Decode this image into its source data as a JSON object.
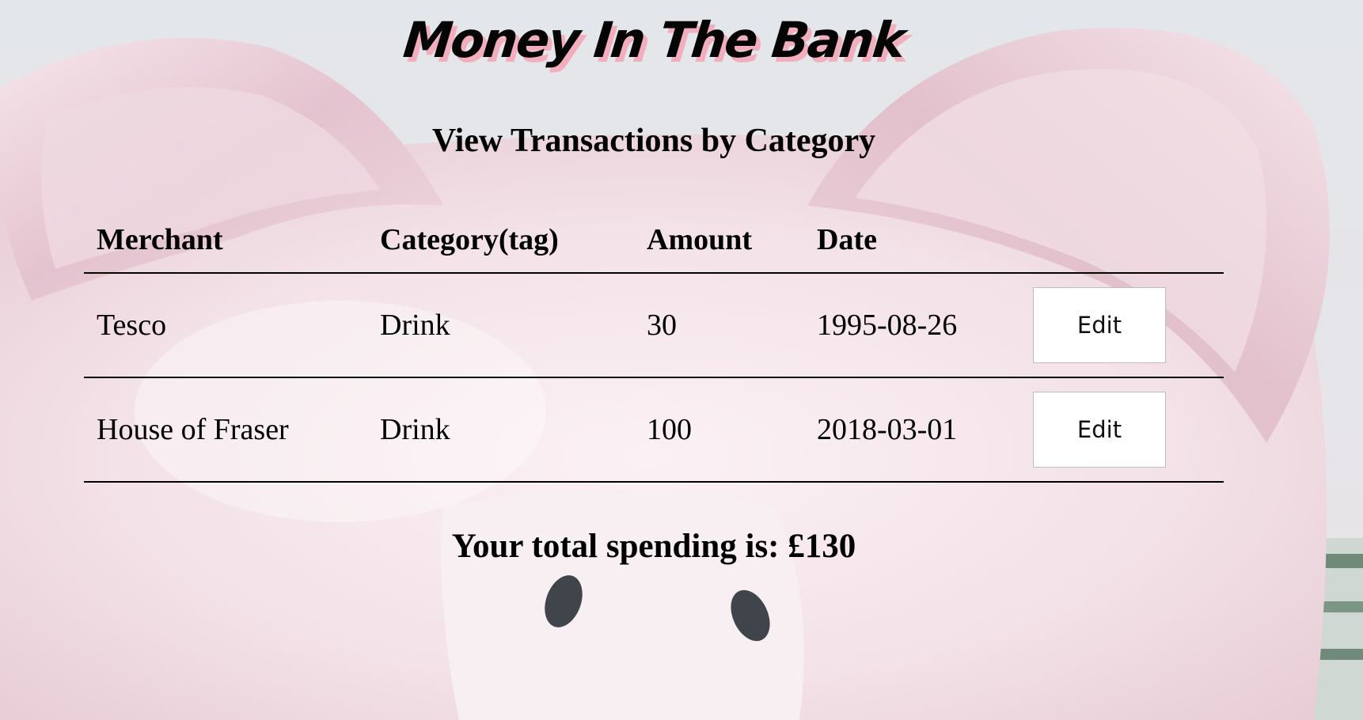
{
  "header": {
    "title": "Money In The Bank"
  },
  "page": {
    "heading": "View Transactions by Category"
  },
  "table": {
    "columns": [
      "Merchant",
      "Category(tag)",
      "Amount",
      "Date"
    ],
    "rows": [
      {
        "merchant": "Tesco",
        "category": "Drink",
        "amount": "30",
        "date": "1995-08-26",
        "action": "Edit"
      },
      {
        "merchant": "House of Fraser",
        "category": "Drink",
        "amount": "100",
        "date": "2018-03-01",
        "action": "Edit"
      }
    ]
  },
  "summary": {
    "total_text": "Your total spending is: £130"
  },
  "colors": {
    "title_shadow": "#f2aebd",
    "pig_pink": "#f0d9e1",
    "button_bg": "#ffffff"
  }
}
